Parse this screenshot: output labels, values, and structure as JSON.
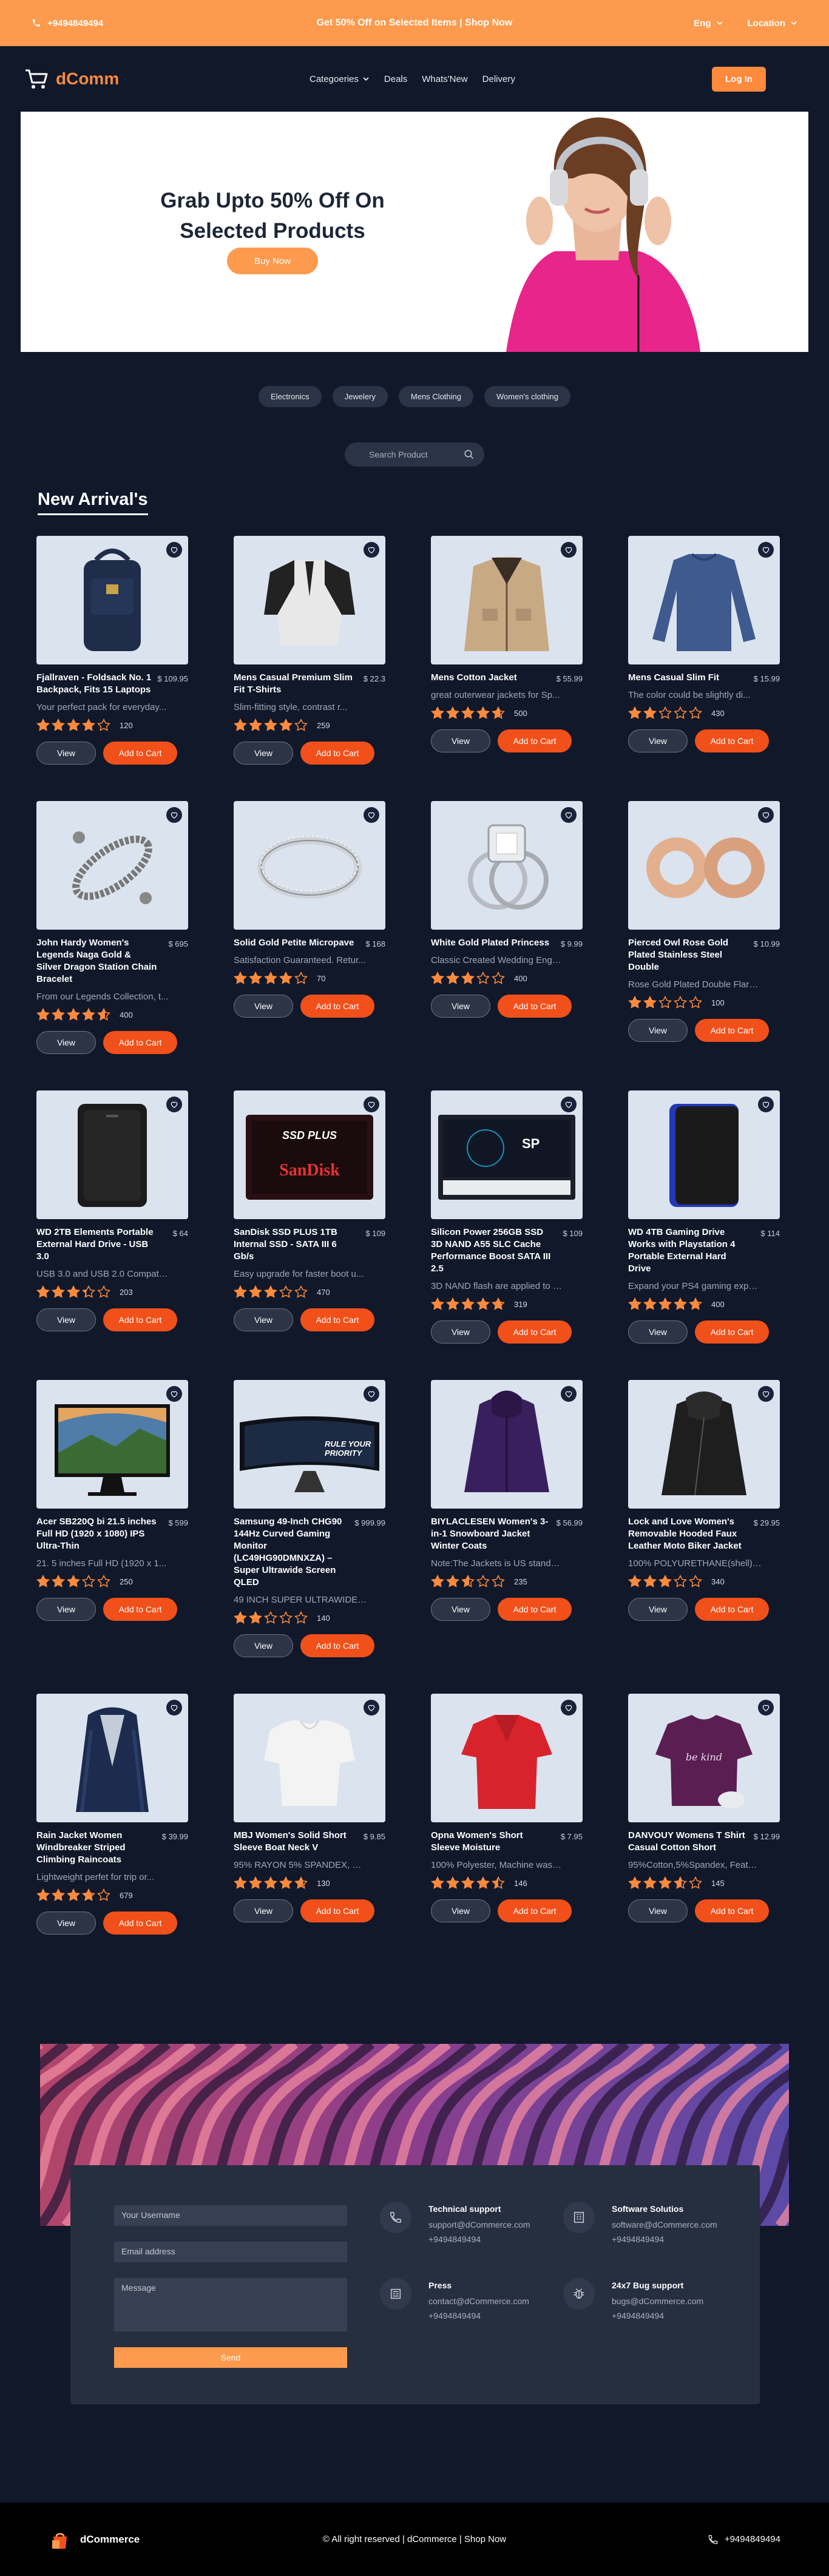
{
  "topbar": {
    "phone": "+9494849494",
    "promo": "Get 50% Off on Selected Items | Shop Now",
    "lang": "Eng",
    "location": "Location"
  },
  "nav": {
    "brand": "dComm",
    "links": [
      "Categoeries",
      "Deals",
      "Whats'New",
      "Delivery"
    ],
    "login": "Log In"
  },
  "hero": {
    "title": "Grab Upto 50% Off On Selected Products",
    "cta": "Buy Now"
  },
  "categories": [
    "Electronics",
    "Jewelery",
    "Mens Clothing",
    "Women's clothing"
  ],
  "search": {
    "placeholder": "Search Product"
  },
  "section_title": "New Arrival's",
  "buttons": {
    "view": "View",
    "add": "Add to Cart"
  },
  "products": [
    {
      "name": "Fjallraven - Foldsack No. 1 Backpack, Fits 15 Laptops",
      "price": "$ 109.95",
      "desc": "Your perfect pack for everyday...",
      "rating": 3.9,
      "count": "120",
      "art": "bag"
    },
    {
      "name": "Mens Casual Premium Slim Fit T-Shirts",
      "price": "$ 22.3",
      "desc": "Slim-fitting style, contrast r...",
      "rating": 4.1,
      "count": "259",
      "art": "henley"
    },
    {
      "name": "Mens Cotton Jacket",
      "price": "$ 55.99",
      "desc": "great outerwear jackets for Sp...",
      "rating": 4.7,
      "count": "500",
      "art": "jacket"
    },
    {
      "name": "Mens Casual Slim Fit",
      "price": "$ 15.99",
      "desc": "The color could be slightly di...",
      "rating": 2.1,
      "count": "430",
      "art": "longsleeve"
    },
    {
      "name": "John Hardy Women's Legends Naga Gold & Silver Dragon Station Chain Bracelet",
      "price": "$ 695",
      "desc": "From our Legends Collection, t...",
      "rating": 4.6,
      "count": "400",
      "art": "bracelet"
    },
    {
      "name": "Solid Gold Petite Micropave",
      "price": "$ 168",
      "desc": "Satisfaction Guaranteed. Retur...",
      "rating": 3.9,
      "count": "70",
      "art": "ring"
    },
    {
      "name": "White Gold Plated Princess",
      "price": "$ 9.99",
      "desc": "Classic Created Wedding Engage...",
      "rating": 3,
      "count": "400",
      "art": "diamond"
    },
    {
      "name": "Pierced Owl Rose Gold Plated Stainless Steel Double",
      "price": "$ 10.99",
      "desc": "Rose Gold Plated Double Flared...",
      "rating": 1.9,
      "count": "100",
      "art": "plugs"
    },
    {
      "name": "WD 2TB Elements Portable External Hard Drive - USB 3.0",
      "price": "$ 64",
      "desc": "USB 3.0 and USB 2.0 Compatibil...",
      "rating": 3.3,
      "count": "203",
      "art": "hdd"
    },
    {
      "name": "SanDisk SSD PLUS 1TB Internal SSD - SATA III 6 Gb/s",
      "price": "$ 109",
      "desc": "Easy upgrade for faster boot u...",
      "rating": 2.9,
      "count": "470",
      "art": "ssd"
    },
    {
      "name": "Silicon Power 256GB SSD 3D NAND A55 SLC Cache Performance Boost SATA III 2.5",
      "price": "$ 109",
      "desc": "3D NAND flash are applied to d...",
      "rating": 4.8,
      "count": "319",
      "art": "sp"
    },
    {
      "name": "WD 4TB Gaming Drive Works with Playstation 4 Portable External Hard Drive",
      "price": "$ 114",
      "desc": "Expand your PS4 gaming experie...",
      "rating": 4.8,
      "count": "400",
      "art": "hddblue"
    },
    {
      "name": "Acer SB220Q bi 21.5 inches Full HD (1920 x 1080) IPS Ultra-Thin",
      "price": "$ 599",
      "desc": "21. 5 inches Full HD (1920 x 1...",
      "rating": 2.9,
      "count": "250",
      "art": "monitor"
    },
    {
      "name": "Samsung 49-Inch CHG90 144Hz Curved Gaming Monitor (LC49HG90DMNXZA) – Super Ultrawide Screen QLED",
      "price": "$ 999.99",
      "desc": "49 INCH SUPER ULTRAWIDE 32:9 C...",
      "rating": 2.2,
      "count": "140",
      "art": "ultrawide"
    },
    {
      "name": "BIYLACLESEN Women's 3-in-1 Snowboard Jacket Winter Coats",
      "price": "$ 56.99",
      "desc": "Note:The Jackets is US standar...",
      "rating": 2.6,
      "count": "235",
      "art": "purplejacket"
    },
    {
      "name": "Lock and Love Women's Removable Hooded Faux Leather Moto Biker Jacket",
      "price": "$ 29.95",
      "desc": "100% POLYURETHANE(shell) 100% ...",
      "rating": 2.9,
      "count": "340",
      "art": "leather"
    },
    {
      "name": "Rain Jacket Women Windbreaker Striped Climbing Raincoats",
      "price": "$ 39.99",
      "desc": "Lightweight perfet for trip or...",
      "rating": 3.8,
      "count": "679",
      "art": "raincoat"
    },
    {
      "name": "MBJ Women's Solid Short Sleeve Boat Neck V",
      "price": "$ 9.85",
      "desc": "95% RAYON 5% SPANDEX, Made in ...",
      "rating": 4.7,
      "count": "130",
      "art": "whitetop"
    },
    {
      "name": "Opna Women's Short Sleeve Moisture",
      "price": "$ 7.95",
      "desc": "100% Polyester, Machine wash, ...",
      "rating": 4.5,
      "count": "146",
      "art": "redshirt"
    },
    {
      "name": "DANVOUY Womens T Shirt Casual Cotton Short",
      "price": "$ 12.99",
      "desc": "95%Cotton,5%Spandex, Features...",
      "rating": 3.6,
      "count": "145",
      "art": "purpletee"
    }
  ],
  "contact": {
    "username": "Your Username",
    "email": "Email address",
    "message": "Message",
    "send": "Send",
    "blocks": [
      {
        "title": "Technical support",
        "line1": "support@dCommerce.com",
        "line2": "+9494849494",
        "icon": "phone-icon"
      },
      {
        "title": "Software Solutios",
        "line1": "software@dCommerce.com",
        "line2": "+9494849494",
        "icon": "building-icon"
      },
      {
        "title": "Press",
        "line1": "contact@dCommerce.com",
        "line2": "+9494849494",
        "icon": "newspaper-icon"
      },
      {
        "title": "24x7 Bug support",
        "line1": "bugs@dCommerce.com",
        "line2": "+9494849494",
        "icon": "bug-icon"
      }
    ]
  },
  "footer": {
    "brand": "dCommerce",
    "copyright": "© All right reserved | dCommerce | Shop Now",
    "phone": "+9494849494"
  },
  "colors": {
    "accent": "#fd9a4d",
    "bg": "#10182a",
    "add": "#f1501a",
    "star": "#fd8a3d"
  }
}
